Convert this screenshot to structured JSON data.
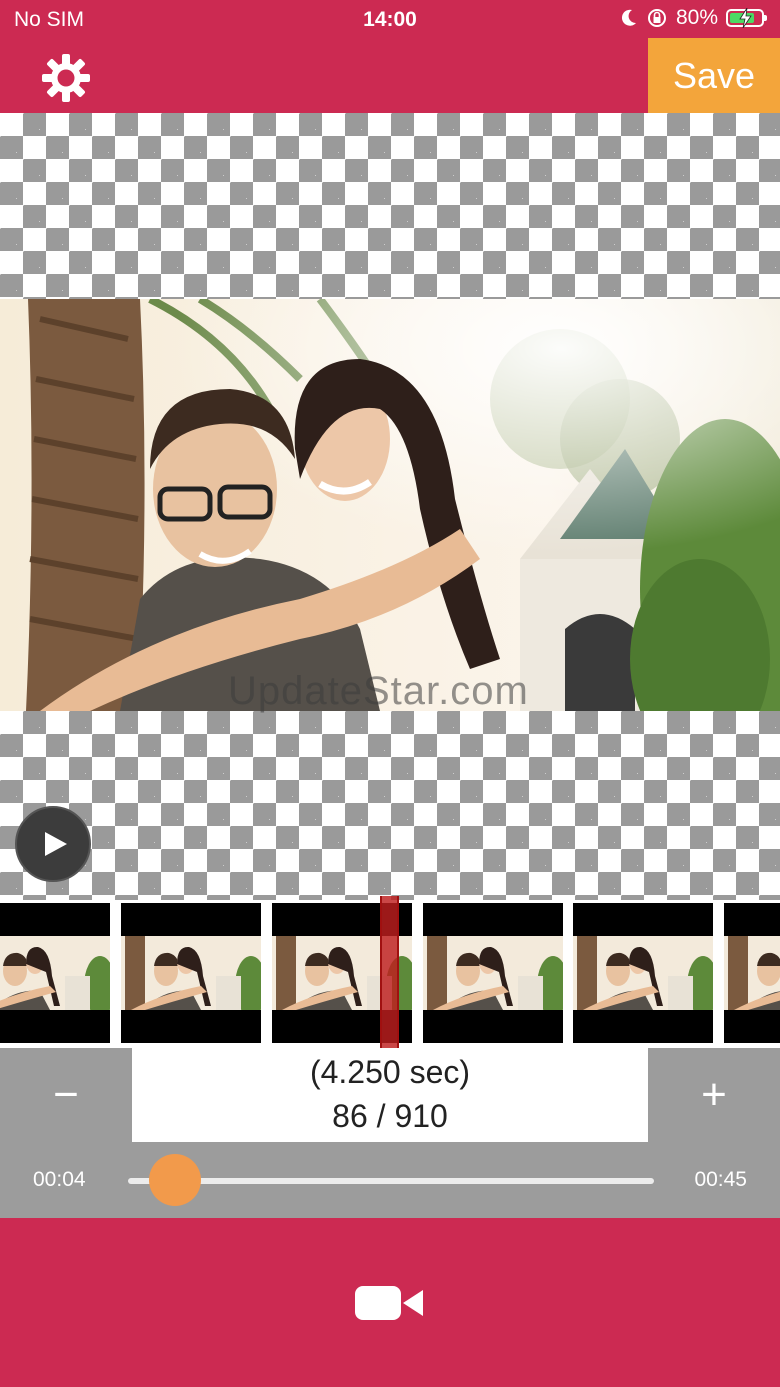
{
  "status_bar": {
    "carrier": "No SIM",
    "time": "14:00",
    "battery_text": "80%",
    "battery_level": 0.8,
    "icons": [
      "moon-icon",
      "rotation-lock-icon",
      "battery-charging-icon"
    ]
  },
  "header": {
    "settings_icon": "gear-icon",
    "save_label": "Save"
  },
  "preview": {
    "watermark": "UpdateStar.com",
    "play_icon": "play-icon"
  },
  "frame_stepper": {
    "minus_label": "−",
    "plus_label": "+",
    "time_label": "(4.250 sec)",
    "frame_label": "86 / 910",
    "current_frame": 86,
    "total_frames": 910
  },
  "trim_slider": {
    "start_label": "00:04",
    "end_label": "00:45",
    "position": 0.09
  },
  "bottom": {
    "record_icon": "video-camera-icon"
  },
  "colors": {
    "brand": "#cc2a52",
    "accent": "#f3a53b",
    "slider_thumb": "#f29a4b",
    "panel_gray": "#9c9c9c"
  }
}
